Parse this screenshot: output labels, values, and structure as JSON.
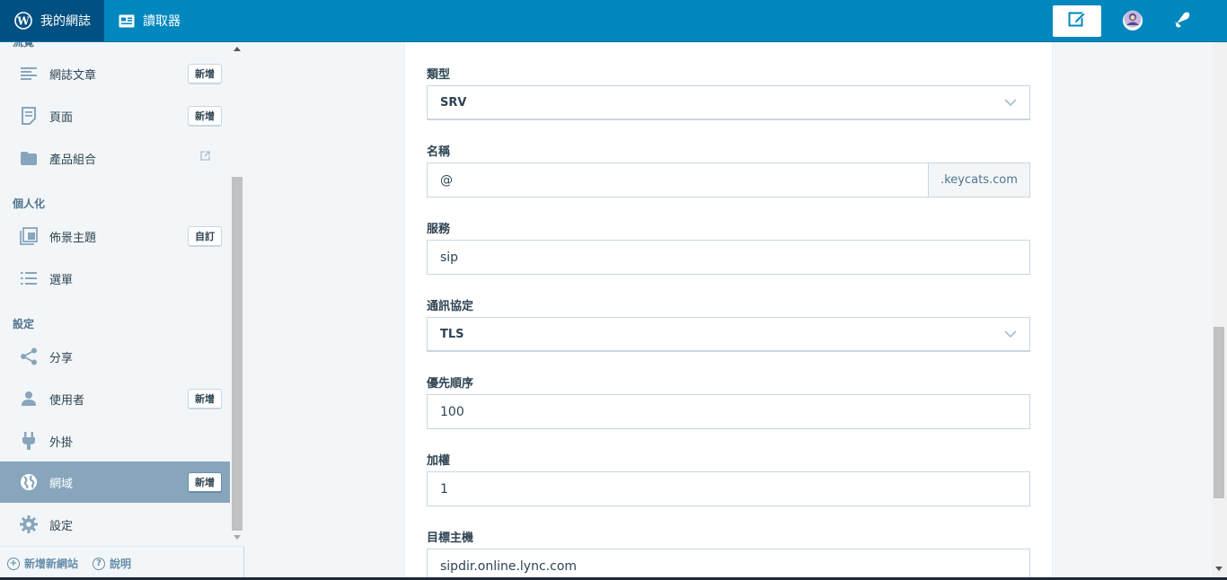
{
  "masterbar": {
    "my_sites_label": "我的網誌",
    "reader_label": "讀取器"
  },
  "sidebar": {
    "cut_heading": "流覽",
    "items_top": [
      {
        "label": "網誌文章",
        "action": "新增"
      },
      {
        "label": "頁面",
        "action": "新增"
      },
      {
        "label": "產品組合"
      }
    ],
    "personalize_heading": "個人化",
    "items_personalize": [
      {
        "label": "佈景主題",
        "action": "自訂"
      },
      {
        "label": "選單"
      }
    ],
    "settings_heading": "設定",
    "items_settings": [
      {
        "label": "分享"
      },
      {
        "label": "使用者",
        "action": "新增"
      },
      {
        "label": "外掛"
      },
      {
        "label": "網域",
        "action": "新增"
      },
      {
        "label": "設定"
      }
    ],
    "footer": {
      "add_site": "新增新網站",
      "help": "說明"
    }
  },
  "form": {
    "type": {
      "label": "類型",
      "value": "SRV"
    },
    "name": {
      "label": "名稱",
      "value": "@",
      "suffix": ".keycats.com"
    },
    "service": {
      "label": "服務",
      "value": "sip"
    },
    "protocol": {
      "label": "通訊協定",
      "value": "TLS"
    },
    "priority": {
      "label": "優先順序",
      "value": "100"
    },
    "weight": {
      "label": "加權",
      "value": "1"
    },
    "target": {
      "label": "目標主機",
      "value": "sipdir.online.lync.com"
    }
  },
  "colors": {
    "masterbar": "#0087be",
    "masterbar_active": "#005082",
    "sidebar_selected": "#87a6bc"
  }
}
